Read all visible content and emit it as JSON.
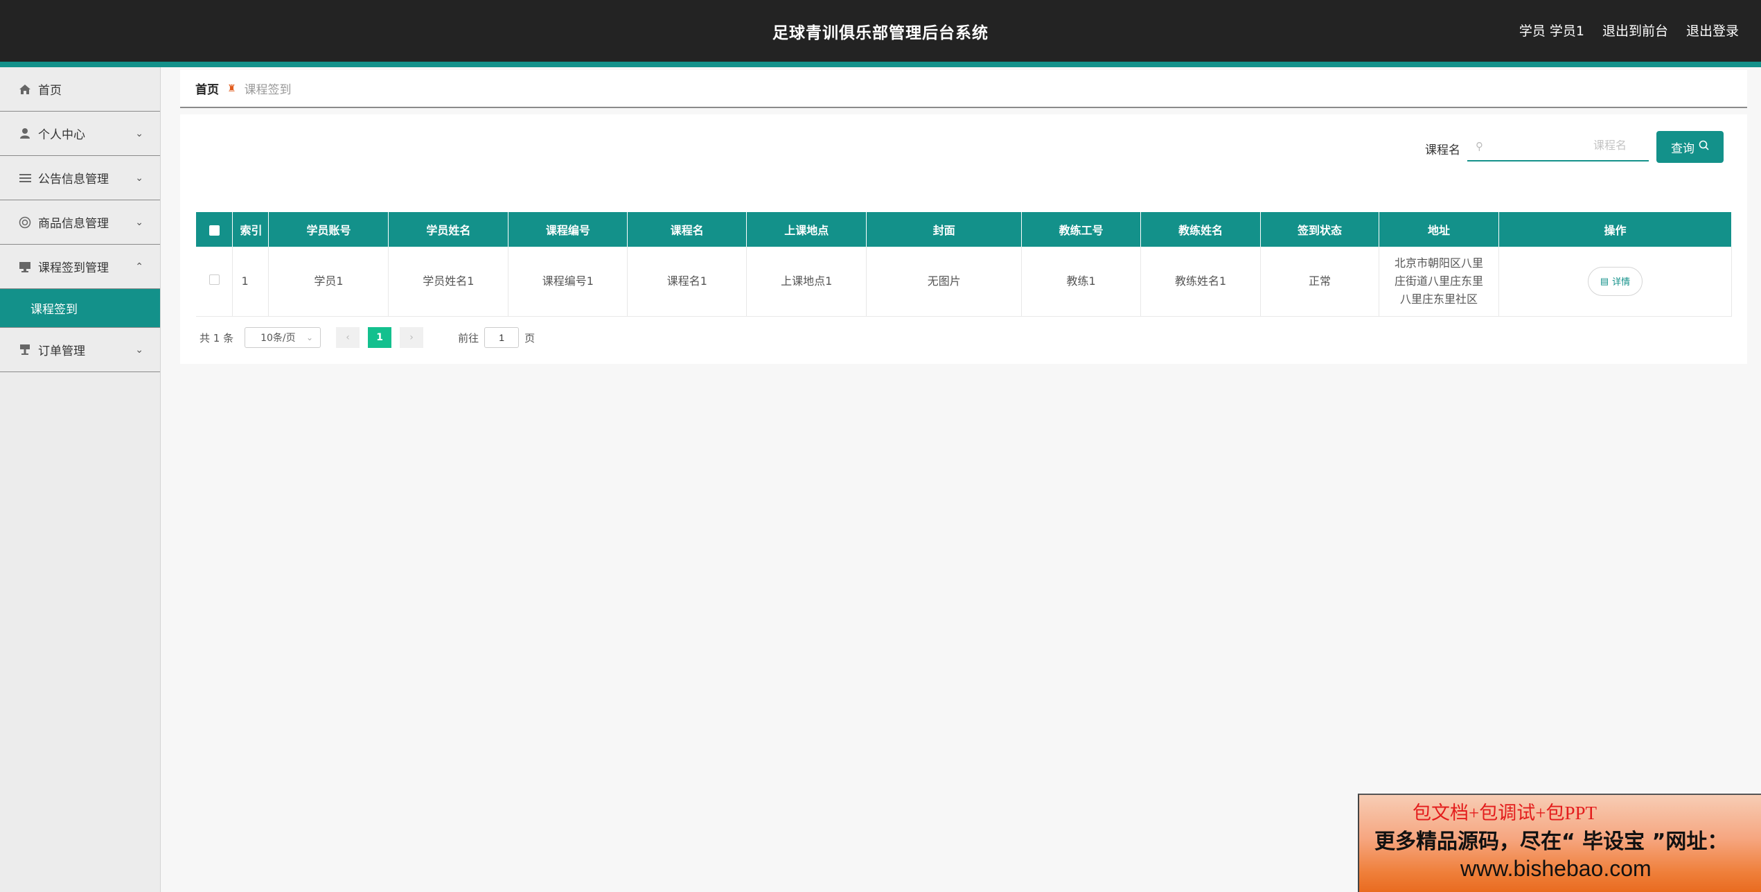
{
  "header": {
    "title": "足球青训俱乐部管理后台系统",
    "user_label": "学员 学员1",
    "to_frontend": "退出到前台",
    "logout": "退出登录"
  },
  "sidebar": {
    "items": [
      {
        "label": "首页",
        "icon": "home-icon"
      },
      {
        "label": "个人中心",
        "icon": "user-icon"
      },
      {
        "label": "公告信息管理",
        "icon": "list-icon"
      },
      {
        "label": "商品信息管理",
        "icon": "globe-icon"
      },
      {
        "label": "课程签到管理",
        "icon": "monitor-icon",
        "expanded": true
      },
      {
        "label": "订单管理",
        "icon": "stand-icon"
      }
    ],
    "active_sub": "课程签到"
  },
  "breadcrumb": {
    "home": "首页",
    "current": "课程签到"
  },
  "search": {
    "label": "课程名",
    "placeholder": "课程名",
    "button": "查询"
  },
  "table": {
    "columns": [
      "索引",
      "学员账号",
      "学员姓名",
      "课程编号",
      "课程名",
      "上课地点",
      "封面",
      "教练工号",
      "教练姓名",
      "签到状态",
      "地址",
      "操作"
    ],
    "rows": [
      {
        "index": "1",
        "account": "学员1",
        "name": "学员姓名1",
        "course_no": "课程编号1",
        "course_name": "课程名1",
        "location": "上课地点1",
        "cover": "无图片",
        "coach_no": "教练1",
        "coach_name": "教练姓名1",
        "status": "正常",
        "address": "北京市朝阳区八里庄街道八里庄东里八里庄东里社区",
        "action": "详情"
      }
    ]
  },
  "pagination": {
    "total": "共 1 条",
    "page_size": "10条/页",
    "current_page": "1",
    "goto_label": "前往",
    "goto_value": "1",
    "page_suffix": "页"
  },
  "ad": {
    "line1": "包文档+包调试+包PPT",
    "line2": "更多精品源码，尽在“ 毕设宝 ”网址：",
    "line3": "www.bishebao.com"
  },
  "colors": {
    "accent": "#13918a",
    "header_bg": "#232323",
    "current_page": "#13c08e"
  }
}
